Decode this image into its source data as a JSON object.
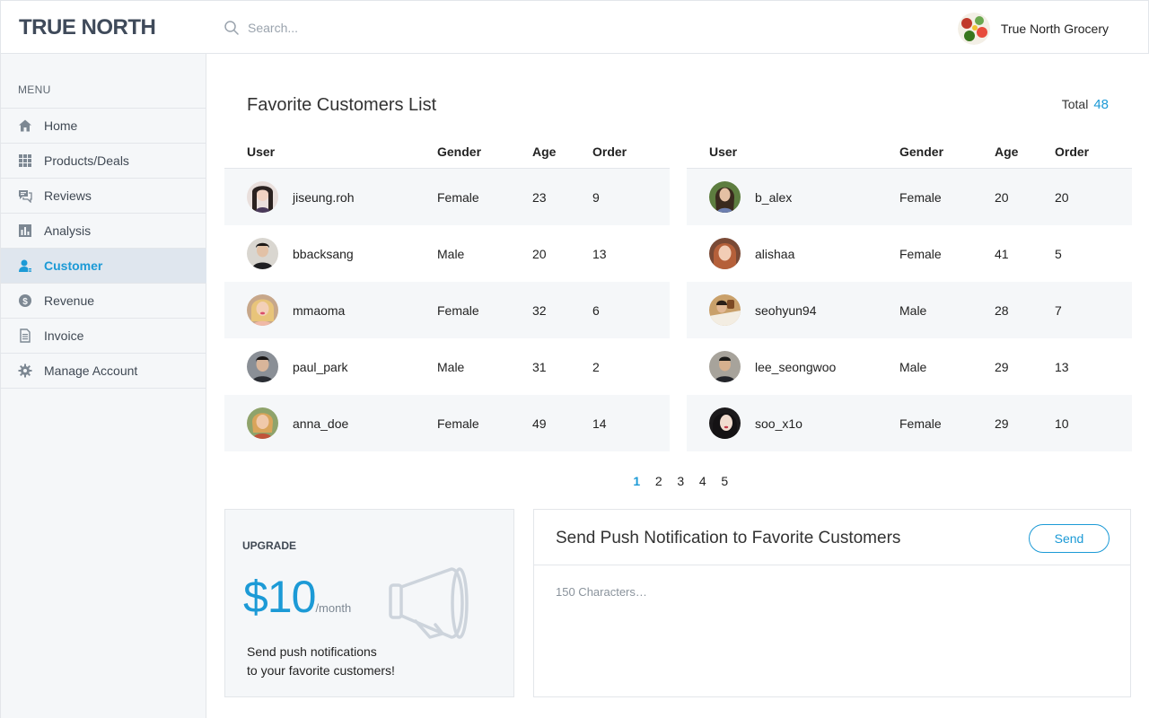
{
  "header": {
    "logo": "TRUE NORTH",
    "search_placeholder": "Search...",
    "account_name": "True North Grocery"
  },
  "sidebar": {
    "menu_label": "MENU",
    "items": [
      {
        "label": "Home",
        "icon": "home-icon"
      },
      {
        "label": "Products/Deals",
        "icon": "grid-icon"
      },
      {
        "label": "Reviews",
        "icon": "chat-icon"
      },
      {
        "label": "Analysis",
        "icon": "bar-chart-icon"
      },
      {
        "label": "Customer",
        "icon": "user-icon",
        "active": true
      },
      {
        "label": "Revenue",
        "icon": "dollar-icon"
      },
      {
        "label": "Invoice",
        "icon": "document-icon"
      },
      {
        "label": "Manage Account",
        "icon": "gear-icon"
      }
    ]
  },
  "customers": {
    "title": "Favorite Customers List",
    "total_label": "Total",
    "total_value": "48",
    "columns": [
      "User",
      "Gender",
      "Age",
      "Order"
    ],
    "left": [
      {
        "user": "jiseung.roh",
        "gender": "Female",
        "age": "23",
        "order": "9"
      },
      {
        "user": "bbacksang",
        "gender": "Male",
        "age": "20",
        "order": "13"
      },
      {
        "user": "mmaoma",
        "gender": "Female",
        "age": "32",
        "order": "6"
      },
      {
        "user": "paul_park",
        "gender": "Male",
        "age": "31",
        "order": "2"
      },
      {
        "user": "anna_doe",
        "gender": "Female",
        "age": "49",
        "order": "14"
      }
    ],
    "right": [
      {
        "user": "b_alex",
        "gender": "Female",
        "age": "20",
        "order": "20"
      },
      {
        "user": "alishaa",
        "gender": "Female",
        "age": "41",
        "order": "5"
      },
      {
        "user": "seohyun94",
        "gender": "Male",
        "age": "28",
        "order": "7"
      },
      {
        "user": "lee_seongwoo",
        "gender": "Male",
        "age": "29",
        "order": "13"
      },
      {
        "user": "soo_x1o",
        "gender": "Female",
        "age": "29",
        "order": "10"
      }
    ],
    "pages": [
      "1",
      "2",
      "3",
      "4",
      "5"
    ],
    "current_page": "1"
  },
  "upgrade": {
    "label": "UPGRADE",
    "price": "$10",
    "period": "/month",
    "line1": "Send push notifications",
    "line2": "to your favorite customers!",
    "icon": "megaphone-icon"
  },
  "notification": {
    "title": "Send Push Notification to Favorite Customers",
    "send_label": "Send",
    "placeholder": "150 Characters…"
  },
  "colors": {
    "accent": "#1c9ad6",
    "sidebar_bg": "#f5f7f9",
    "active_item_bg": "#dfe6ee",
    "logo": "#3f4a5a"
  }
}
